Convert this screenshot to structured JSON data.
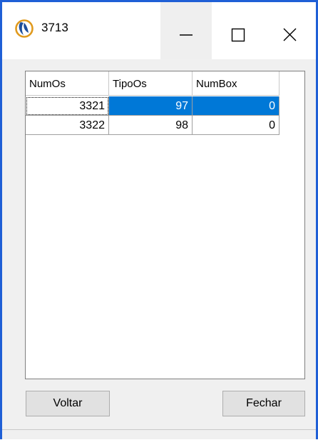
{
  "window": {
    "title": "3713",
    "icon": "app-logo-icon",
    "controls": {
      "minimize": "minimize-icon",
      "maximize": "maximize-icon",
      "close": "close-icon"
    },
    "border_color": "#1f5fd6"
  },
  "grid": {
    "columns": [
      "NumOs",
      "TipoOs",
      "NumBox"
    ],
    "rows": [
      [
        "3321",
        "97",
        "0"
      ],
      [
        "3322",
        "98",
        "0"
      ]
    ],
    "selected_row": 0,
    "selection_color": "#0078d7"
  },
  "buttons": {
    "voltar": "Voltar",
    "fechar": "Fechar"
  }
}
